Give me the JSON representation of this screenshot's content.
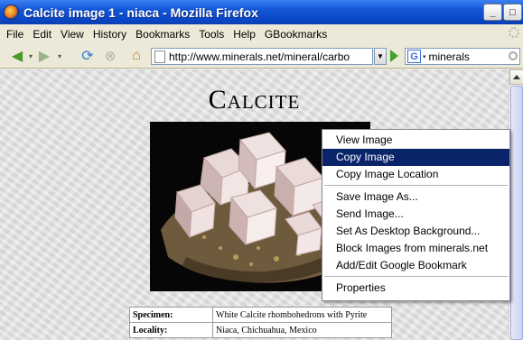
{
  "window": {
    "title": "Calcite image 1 - niaca - Mozilla Firefox",
    "minimize_label": "_",
    "maximize_label": "□"
  },
  "menubar": [
    "File",
    "Edit",
    "View",
    "History",
    "Bookmarks",
    "Tools",
    "Help",
    "GBookmarks"
  ],
  "navigation": {
    "url": "http://www.minerals.net/mineral/carbo",
    "search_engine_letter": "G",
    "search_value": "minerals"
  },
  "page": {
    "title": "Calcite",
    "table": [
      {
        "label": "Specimen:",
        "value": "White Calcite rhombohedrons with Pyrite"
      },
      {
        "label": "Locality:",
        "value": "Niaca, Chichuahua, Mexico"
      }
    ]
  },
  "context_menu": {
    "items": [
      {
        "label": "View Image",
        "selected": false
      },
      {
        "label": "Copy Image",
        "selected": true
      },
      {
        "label": "Copy Image Location",
        "selected": false
      },
      {
        "separator": true
      },
      {
        "label": "Save Image As...",
        "selected": false
      },
      {
        "label": "Send Image...",
        "selected": false
      },
      {
        "label": "Set As Desktop Background...",
        "selected": false
      },
      {
        "label": "Block Images from minerals.net",
        "selected": false
      },
      {
        "label": "Add/Edit Google Bookmark",
        "selected": false
      },
      {
        "separator": true
      },
      {
        "label": "Properties",
        "selected": false
      }
    ]
  },
  "colors": {
    "title_bar": "#0a47c8",
    "selection": "#0a246a"
  },
  "icons": {
    "window": "firefox-icon",
    "nav": [
      "back-icon",
      "forward-icon",
      "reload-icon",
      "stop-icon",
      "home-icon",
      "page-icon",
      "go-icon"
    ],
    "search": "google-icon"
  }
}
